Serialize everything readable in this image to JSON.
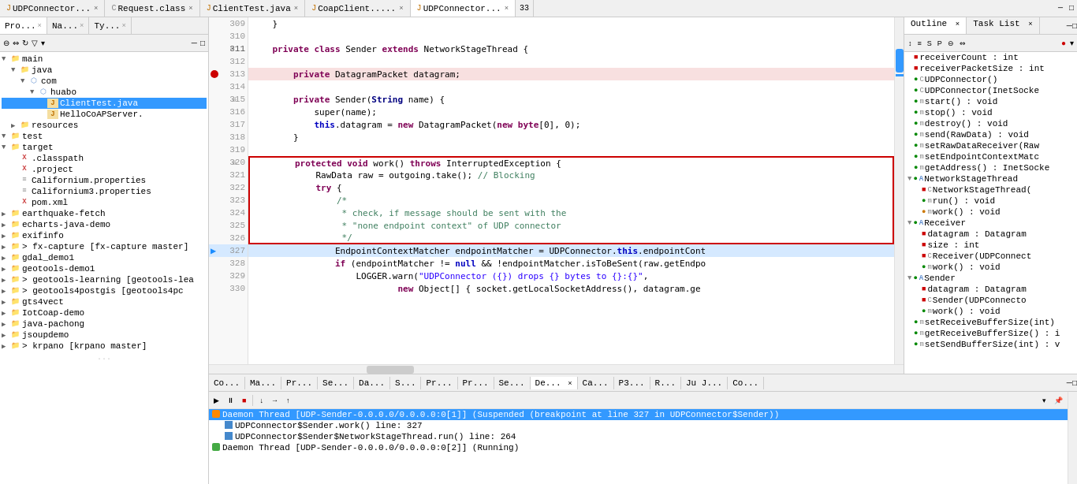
{
  "tabs": {
    "items": [
      {
        "label": "UDPConnector...",
        "icon": "java",
        "active": false,
        "closeable": true
      },
      {
        "label": "Request.class",
        "icon": "class",
        "active": false,
        "closeable": true
      },
      {
        "label": "ClientTest.java",
        "icon": "java",
        "active": false,
        "closeable": true
      },
      {
        "label": "CoapClient.....",
        "icon": "java",
        "active": false,
        "closeable": true
      },
      {
        "label": "UDPConnector...",
        "icon": "java",
        "active": true,
        "closeable": true
      }
    ],
    "overflow": "33"
  },
  "sidebar": {
    "tabs": [
      "Pro...",
      "Na...",
      "Ty..."
    ],
    "tree": [
      {
        "indent": 0,
        "arrow": "▼",
        "icon": "folder",
        "label": "main",
        "type": "folder"
      },
      {
        "indent": 1,
        "arrow": "▼",
        "icon": "folder",
        "label": "java",
        "type": "folder"
      },
      {
        "indent": 2,
        "arrow": "▼",
        "icon": "package",
        "label": "com",
        "type": "package"
      },
      {
        "indent": 3,
        "arrow": "▼",
        "icon": "package",
        "label": "huabo",
        "type": "package"
      },
      {
        "indent": 4,
        "arrow": "",
        "icon": "java",
        "label": "ClientTest.java",
        "type": "java",
        "selected": true
      },
      {
        "indent": 4,
        "arrow": "",
        "icon": "java",
        "label": "HelloCoAPServer.",
        "type": "java"
      },
      {
        "indent": 1,
        "arrow": "▶",
        "icon": "folder",
        "label": "resources",
        "type": "folder"
      },
      {
        "indent": 0,
        "arrow": "▼",
        "icon": "folder",
        "label": "test",
        "type": "folder"
      },
      {
        "indent": 0,
        "arrow": "▼",
        "icon": "folder",
        "label": "target",
        "type": "folder"
      },
      {
        "indent": 1,
        "arrow": "",
        "icon": "xml",
        "label": ".classpath",
        "type": "xml"
      },
      {
        "indent": 1,
        "arrow": "",
        "icon": "xml",
        "label": ".project",
        "type": "xml"
      },
      {
        "indent": 1,
        "arrow": "",
        "icon": "prop",
        "label": "Californium.properties",
        "type": "prop"
      },
      {
        "indent": 1,
        "arrow": "",
        "icon": "prop",
        "label": "Californium3.properties",
        "type": "prop"
      },
      {
        "indent": 1,
        "arrow": "",
        "icon": "xml",
        "label": "pom.xml",
        "type": "xml"
      },
      {
        "indent": 0,
        "arrow": "▶",
        "icon": "folder",
        "label": "earthquake-fetch",
        "type": "folder"
      },
      {
        "indent": 0,
        "arrow": "▶",
        "icon": "folder",
        "label": "echarts-java-demo",
        "type": "folder"
      },
      {
        "indent": 0,
        "arrow": "▶",
        "icon": "folder",
        "label": "exifinfo",
        "type": "folder"
      },
      {
        "indent": 0,
        "arrow": "▶",
        "icon": "folder",
        "label": "fx-capture [fx-capture master]",
        "type": "folder"
      },
      {
        "indent": 0,
        "arrow": "▶",
        "icon": "folder",
        "label": "gdal_demo1",
        "type": "folder"
      },
      {
        "indent": 0,
        "arrow": "▶",
        "icon": "folder",
        "label": "geotools-demo1",
        "type": "folder"
      },
      {
        "indent": 0,
        "arrow": "▶",
        "icon": "folder",
        "label": "geotools-learning [geotools-lea",
        "type": "folder"
      },
      {
        "indent": 0,
        "arrow": "▶",
        "icon": "folder",
        "label": "geotools4postgis [geotools4pc",
        "type": "folder"
      },
      {
        "indent": 0,
        "arrow": "▶",
        "icon": "folder",
        "label": "gts4vect",
        "type": "folder"
      },
      {
        "indent": 0,
        "arrow": "▶",
        "icon": "folder",
        "label": "IotCoap-demo",
        "type": "folder"
      },
      {
        "indent": 0,
        "arrow": "▶",
        "icon": "folder",
        "label": "java-pachong",
        "type": "folder"
      },
      {
        "indent": 0,
        "arrow": "▶",
        "icon": "folder",
        "label": "jsoupdemo",
        "type": "folder"
      },
      {
        "indent": 0,
        "arrow": "▶",
        "icon": "folder",
        "label": "krpano [krpano master]",
        "type": "folder"
      }
    ]
  },
  "editor": {
    "title": "UDPConnector.java",
    "lines": [
      {
        "num": "309",
        "content": "    }",
        "indent": 4,
        "tokens": [
          {
            "text": "    }",
            "cls": "normal"
          }
        ]
      },
      {
        "num": "310",
        "content": "",
        "tokens": []
      },
      {
        "num": "311",
        "content": "    private class Sender extends NetworkStageThread {",
        "fold": true,
        "tokens": [
          {
            "text": "    ",
            "cls": "normal"
          },
          {
            "text": "private",
            "cls": "kw"
          },
          {
            "text": " ",
            "cls": "normal"
          },
          {
            "text": "class",
            "cls": "kw"
          },
          {
            "text": " Sender ",
            "cls": "normal"
          },
          {
            "text": "extends",
            "cls": "kw"
          },
          {
            "text": " NetworkStageThread {",
            "cls": "normal"
          }
        ]
      },
      {
        "num": "312",
        "content": "",
        "tokens": []
      },
      {
        "num": "313",
        "content": "        private DatagramPacket datagram;",
        "breakpoint": true,
        "tokens": [
          {
            "text": "        ",
            "cls": "normal"
          },
          {
            "text": "private",
            "cls": "kw"
          },
          {
            "text": " DatagramPacket datagram;",
            "cls": "normal"
          }
        ]
      },
      {
        "num": "314",
        "content": "",
        "tokens": []
      },
      {
        "num": "315",
        "content": "        private Sender(String name) {",
        "fold": true,
        "tokens": [
          {
            "text": "        ",
            "cls": "normal"
          },
          {
            "text": "private",
            "cls": "kw"
          },
          {
            "text": " Sender(",
            "cls": "normal"
          },
          {
            "text": "String",
            "cls": "type"
          },
          {
            "text": " name) {",
            "cls": "normal"
          }
        ]
      },
      {
        "num": "316",
        "content": "            super(name);",
        "tokens": [
          {
            "text": "            super(name);",
            "cls": "normal"
          }
        ]
      },
      {
        "num": "317",
        "content": "            this.datagram = new DatagramPacket(new byte[0], 0);",
        "tokens": [
          {
            "text": "            ",
            "cls": "normal"
          },
          {
            "text": "this",
            "cls": "kw2"
          },
          {
            "text": ".datagram = ",
            "cls": "normal"
          },
          {
            "text": "new",
            "cls": "kw"
          },
          {
            "text": " DatagramPacket(",
            "cls": "normal"
          },
          {
            "text": "new",
            "cls": "kw"
          },
          {
            "text": " ",
            "cls": "normal"
          },
          {
            "text": "byte",
            "cls": "kw"
          },
          {
            "text": "[0], 0);",
            "cls": "normal"
          }
        ]
      },
      {
        "num": "318",
        "content": "        }",
        "tokens": [
          {
            "text": "        }",
            "cls": "normal"
          }
        ]
      },
      {
        "num": "319",
        "content": "",
        "tokens": []
      },
      {
        "num": "320",
        "content": "        protected void work() throws InterruptedException {",
        "boxTop": true,
        "fold": true,
        "tokens": [
          {
            "text": "        ",
            "cls": "normal"
          },
          {
            "text": "protected",
            "cls": "kw"
          },
          {
            "text": " ",
            "cls": "normal"
          },
          {
            "text": "void",
            "cls": "kw"
          },
          {
            "text": " work() ",
            "cls": "normal"
          },
          {
            "text": "throws",
            "cls": "kw"
          },
          {
            "text": " InterruptedException {",
            "cls": "normal"
          }
        ]
      },
      {
        "num": "321",
        "content": "            RawData raw = outgoing.take(); // Blocking",
        "inBox": true,
        "tokens": [
          {
            "text": "            RawData raw = outgoing.take(); ",
            "cls": "normal"
          },
          {
            "text": "// Blocking",
            "cls": "cm"
          }
        ]
      },
      {
        "num": "322",
        "content": "            try {",
        "inBox": true,
        "tokens": [
          {
            "text": "            ",
            "cls": "normal"
          },
          {
            "text": "try",
            "cls": "kw"
          },
          {
            "text": " {",
            "cls": "normal"
          }
        ]
      },
      {
        "num": "323",
        "content": "                /*",
        "inBox": true,
        "tokens": [
          {
            "text": "                ",
            "cls": "normal"
          },
          {
            "text": "/*",
            "cls": "cm"
          }
        ]
      },
      {
        "num": "324",
        "content": "                 * check, if message should be sent with the",
        "inBox": true,
        "tokens": [
          {
            "text": "                 * check, if message should be sent ",
            "cls": "cm"
          },
          {
            "text": "with",
            "cls": "cm"
          },
          {
            "text": " the",
            "cls": "cm"
          }
        ]
      },
      {
        "num": "325",
        "content": "                 * \"none endpoint context\" of UDP connector",
        "inBox": true,
        "tokens": [
          {
            "text": "                 * \"none endpoint context\" of UDP connector",
            "cls": "cm"
          }
        ]
      },
      {
        "num": "326",
        "content": "                 */",
        "boxBottom": true,
        "tokens": [
          {
            "text": "                 */",
            "cls": "cm"
          }
        ]
      },
      {
        "num": "327",
        "content": "                EndpointContextMatcher endpointMatcher = UDPConnector.this.endpointCont",
        "current": true,
        "tokens": [
          {
            "text": "                EndpointContextMatcher endpointMatcher = UDPConnector.",
            "cls": "normal"
          },
          {
            "text": "this",
            "cls": "kw2"
          },
          {
            "text": ".endpointCont",
            "cls": "normal"
          }
        ]
      },
      {
        "num": "328",
        "content": "                if (endpointMatcher != null && !endpointMatcher.isToBeSent(raw.getEndpo",
        "tokens": [
          {
            "text": "                ",
            "cls": "normal"
          },
          {
            "text": "if",
            "cls": "kw"
          },
          {
            "text": " (endpointMatcher != ",
            "cls": "normal"
          },
          {
            "text": "null",
            "cls": "kw2"
          },
          {
            "text": " && !endpointMatcher.isToBeSent(raw.getEndpo",
            "cls": "normal"
          }
        ]
      },
      {
        "num": "329",
        "content": "                    LOGGER.warn(\"UDPConnector ({}) drops {} bytes to {}:{}\",",
        "tokens": [
          {
            "text": "                    LOGGER.warn(",
            "cls": "normal"
          },
          {
            "text": "\"UDPConnector ({}) drops {} bytes to {}:{}\"",
            "cls": "str"
          },
          {
            "text": ",",
            "cls": "normal"
          }
        ]
      },
      {
        "num": "330",
        "content": "                            new Object[] { socket.getLocalSocketAddress(), datagram.ge",
        "tokens": [
          {
            "text": "                            ",
            "cls": "normal"
          },
          {
            "text": "new",
            "cls": "kw"
          },
          {
            "text": " Object[] { socket.getLocalSocketAddress(), datagram.ge",
            "cls": "normal"
          }
        ]
      }
    ]
  },
  "outline": {
    "tabs": [
      "Outline",
      "Task List"
    ],
    "items": [
      {
        "indent": 0,
        "arrow": "",
        "icon": "field",
        "vis": "pri",
        "label": "receiverCount : int"
      },
      {
        "indent": 0,
        "arrow": "",
        "icon": "field",
        "vis": "pri",
        "label": "receiverPacketSize : int"
      },
      {
        "indent": 0,
        "arrow": "",
        "icon": "method",
        "vis": "pub",
        "label": "UDPConnector()"
      },
      {
        "indent": 0,
        "arrow": "",
        "icon": "method",
        "vis": "pub",
        "label": "UDPConnector(InetSocke"
      },
      {
        "indent": 0,
        "arrow": "",
        "icon": "method",
        "vis": "pub",
        "label": "start() : void"
      },
      {
        "indent": 0,
        "arrow": "",
        "icon": "method",
        "vis": "pub",
        "label": "stop() : void"
      },
      {
        "indent": 0,
        "arrow": "",
        "icon": "method",
        "vis": "pub",
        "label": "destroy() : void"
      },
      {
        "indent": 0,
        "arrow": "",
        "icon": "method",
        "vis": "pub",
        "label": "send(RawData) : void"
      },
      {
        "indent": 0,
        "arrow": "",
        "icon": "method",
        "vis": "pub",
        "label": "setRawDataReceiver(Raw"
      },
      {
        "indent": 0,
        "arrow": "",
        "icon": "method",
        "vis": "pub",
        "label": "setEndpointContextMatc"
      },
      {
        "indent": 0,
        "arrow": "",
        "icon": "method",
        "vis": "pub",
        "label": "getAddress() : InetSocke"
      },
      {
        "indent": 0,
        "arrow": "▼",
        "icon": "class",
        "vis": "pub",
        "label": "NetworkStageThread"
      },
      {
        "indent": 1,
        "arrow": "",
        "icon": "method",
        "vis": "pri",
        "label": "NetworkStageThread("
      },
      {
        "indent": 1,
        "arrow": "",
        "icon": "method",
        "vis": "pub",
        "label": "run() : void"
      },
      {
        "indent": 1,
        "arrow": "",
        "icon": "method",
        "vis": "pub",
        "label": "work() : void"
      },
      {
        "indent": 0,
        "arrow": "▼",
        "icon": "class",
        "vis": "pub",
        "label": "Receiver"
      },
      {
        "indent": 1,
        "arrow": "",
        "icon": "field",
        "vis": "pri",
        "label": "datagram : Datagram"
      },
      {
        "indent": 1,
        "arrow": "",
        "icon": "field",
        "vis": "pri",
        "label": "size : int"
      },
      {
        "indent": 1,
        "arrow": "",
        "icon": "method",
        "vis": "pri",
        "label": "Receiver(UDPConnect"
      },
      {
        "indent": 1,
        "arrow": "",
        "icon": "method",
        "vis": "pub",
        "label": "work() : void"
      },
      {
        "indent": 0,
        "arrow": "▼",
        "icon": "class",
        "vis": "pub",
        "label": "Sender"
      },
      {
        "indent": 1,
        "arrow": "",
        "icon": "field",
        "vis": "pri",
        "label": "datagram : Datagram"
      },
      {
        "indent": 1,
        "arrow": "",
        "icon": "method",
        "vis": "pri",
        "label": "Sender(UDPConnecto"
      },
      {
        "indent": 1,
        "arrow": "",
        "icon": "method",
        "vis": "pub",
        "label": "work() : void"
      },
      {
        "indent": 0,
        "arrow": "",
        "icon": "method",
        "vis": "pub",
        "label": "setReceiveBufferSize(int)"
      },
      {
        "indent": 0,
        "arrow": "",
        "icon": "method",
        "vis": "pub",
        "label": "getReceiveBufferSize() : i"
      },
      {
        "indent": 0,
        "arrow": "",
        "icon": "method",
        "vis": "pub",
        "label": "setSendBufferSize(int) : v"
      }
    ]
  },
  "bottom": {
    "tabs": [
      "Co...",
      "Ma...",
      "Pr...",
      "Se...",
      "Da...",
      "S...",
      "Pr...",
      "Pr...",
      "Se...",
      "De...",
      "Ca...",
      "P3...",
      "R...",
      "Ju J...",
      "Co..."
    ],
    "active_tab": "De...",
    "debug_items": [
      {
        "indent": 1,
        "type": "thread",
        "label": "Daemon Thread [UDP-Sender-0.0.0.0/0.0.0.0:0[1]] (Suspended (breakpoint at line 327 in UDPConnector$Sender))",
        "expanded": true
      },
      {
        "indent": 2,
        "type": "frame",
        "label": "UDPConnector$Sender.work() line: 327"
      },
      {
        "indent": 2,
        "type": "frame",
        "label": "UDPConnector$Sender$NetworkStageThread.run() line: 264"
      },
      {
        "indent": 1,
        "type": "thread",
        "label": "Daemon Thread [UDP-Sender-0.0.0.0/0.0.0.0:0[2]] (Running)"
      }
    ]
  }
}
